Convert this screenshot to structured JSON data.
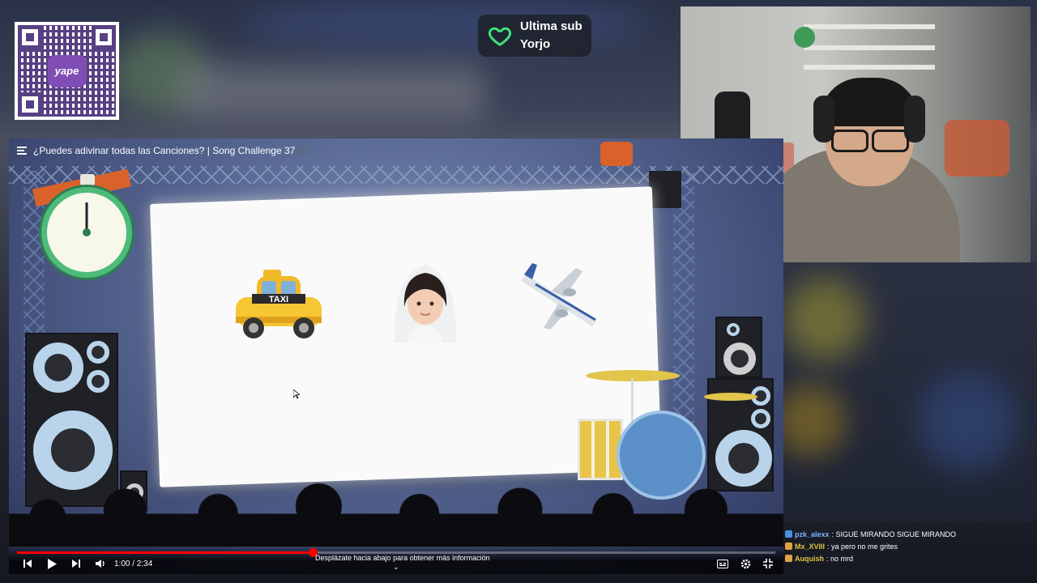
{
  "qr": {
    "logo_text": "yape"
  },
  "last_sub": {
    "label": "Ultima sub",
    "name": "Yorjo",
    "heart_color": "#3fe07a"
  },
  "video": {
    "title": "¿Puedes adivinar todas las Canciones? | Song Challenge 37 🎼",
    "emojis": [
      "taxi",
      "bride-with-veil",
      "airplane"
    ],
    "time": "1:00 / 2:34",
    "progress": 0.39,
    "hint": "Desplázate hacia abajo para obtener más información",
    "hint_chevron": "⌄",
    "accent": "#ff0000"
  },
  "chat": {
    "messages": [
      {
        "user": "pzk_alexx",
        "text": ": SIGUE MIRANDO SIGUE MIRANDO",
        "user_color": "#7ab8ff",
        "badge_color": "#4a90e2"
      },
      {
        "user": "Mx_XVIII",
        "text": ": ya pero no me grites",
        "user_color": "#e0c341",
        "badge_color": "#e0a341"
      },
      {
        "user": "Auquish",
        "text": ": no mrd",
        "user_color": "#e0c341",
        "badge_color": "#e0a341"
      }
    ]
  }
}
